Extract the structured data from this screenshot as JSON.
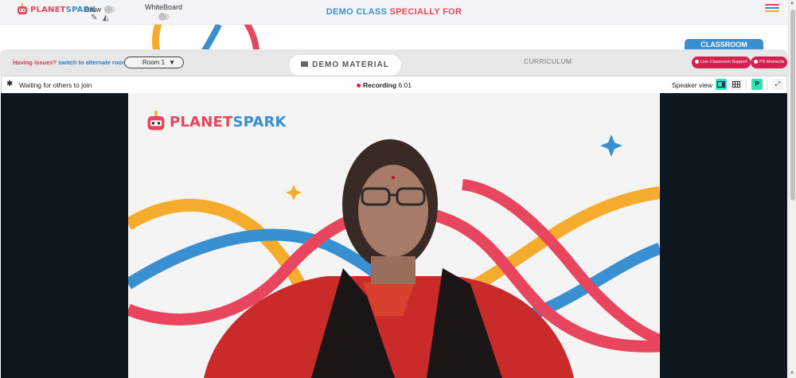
{
  "header": {
    "logo_text_a": "PLANET",
    "logo_text_b": "SPARK",
    "draw_label": "Draw",
    "whiteboard_label": "WhiteBoard",
    "title_part1": "DEMO CLASS",
    "title_part2": "SPECIALLY FOR"
  },
  "toolbar": {
    "issues_text": "Having issues?",
    "switch_link": "switch to alternate room",
    "room_selected": "Room 1",
    "demo_material_label": "DEMO MATERIAL",
    "curriculum_label": "CURRICULUM",
    "classroom_tab_label": "CLASSROOM",
    "live_support_label": "Live Classroom Support",
    "ps_moments_label": "PS Moments"
  },
  "video_header": {
    "waiting_text": "Waiting for others to join",
    "recording_label": "Recording",
    "recording_time": "6:01",
    "speaker_view_label": "Speaker view",
    "participant_initial": "P"
  },
  "stage": {
    "logo_text_a": "PLANET",
    "logo_text_b": "SPARK"
  },
  "colors": {
    "brand_red": "#e8465f",
    "brand_blue": "#3a8fd1",
    "brand_yellow": "#f5ab2b",
    "accent_green": "#2ee3b6",
    "video_bg": "#0f171e"
  },
  "icons": [
    "planetspark-logo-icon",
    "pencil-icon",
    "eraser-icon",
    "hamburger-menu-icon",
    "folder-icon",
    "gear-icon",
    "recording-dot-icon",
    "speaker-view-icon",
    "grid-view-icon",
    "fullscreen-icon",
    "sparkle-icon"
  ]
}
